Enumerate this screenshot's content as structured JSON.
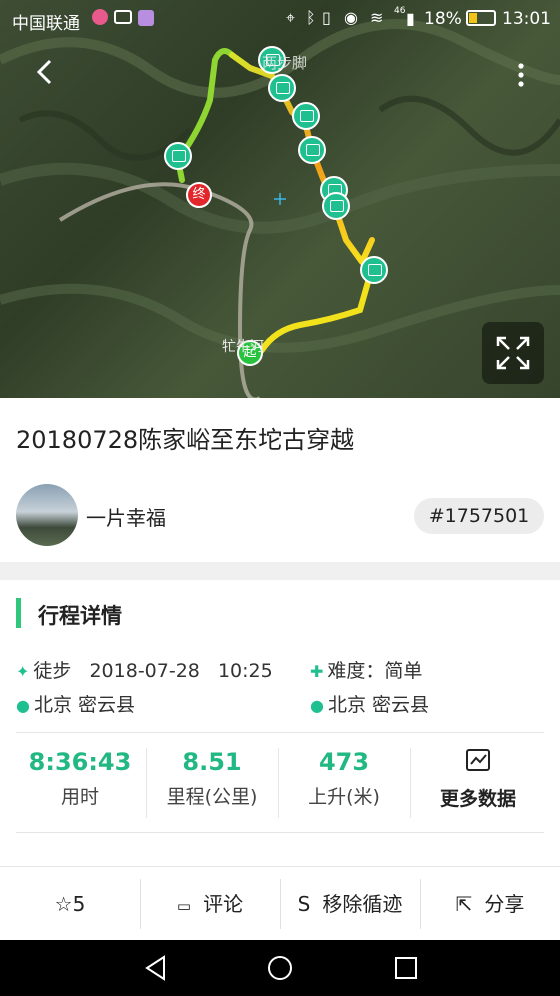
{
  "status_bar": {
    "carrier": "中国联通",
    "network": "46",
    "battery": "18%",
    "time": "13:01"
  },
  "map": {
    "watermark": "两步脚",
    "start_label": "起",
    "end_label": "终",
    "place_label": "牤牛河",
    "back_icon": "back-arrow-icon",
    "more_icon": "more-vertical-icon",
    "expand_icon": "fullscreen-icon"
  },
  "trip": {
    "title": "20180728陈家峪至东坨古穿越"
  },
  "user": {
    "name": "一片幸福",
    "id_tag": "#1757501"
  },
  "details": {
    "section_title": "行程详情",
    "activity_type": "徒步",
    "date": "2018-07-28",
    "time": "10:25",
    "difficulty": "难度：简单",
    "start_location": "北京  密云县",
    "end_location": "北京  密云县"
  },
  "stats": [
    {
      "value": "8:36:43",
      "label": "用时"
    },
    {
      "value": "8.51",
      "label": "里程(公里)"
    },
    {
      "value": "473",
      "label": "上升(米)"
    }
  ],
  "more_data_label": "更多数据",
  "actions": {
    "favorite_count": "5",
    "comment": "评论",
    "remove_track": "移除循迹",
    "share": "分享"
  },
  "colors": {
    "accent": "#22b883",
    "section_bar": "#2ec77c"
  }
}
